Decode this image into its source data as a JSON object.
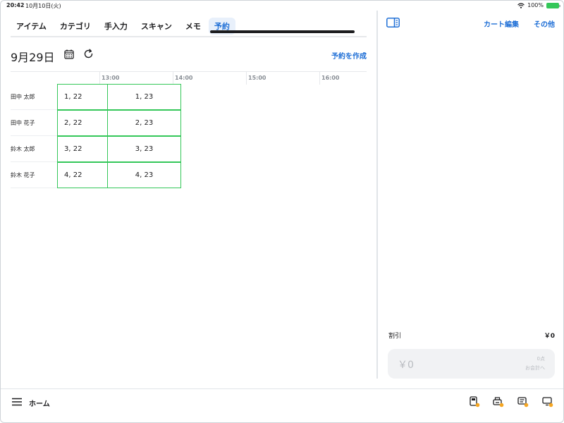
{
  "status_bar": {
    "time": "20:42",
    "date": "10月10日(火)",
    "battery": "100%"
  },
  "tabs": [
    {
      "label": "アイテム",
      "active": false
    },
    {
      "label": "カテゴリ",
      "active": false
    },
    {
      "label": "手入力",
      "active": false
    },
    {
      "label": "スキャン",
      "active": false
    },
    {
      "label": "メモ",
      "active": false
    },
    {
      "label": "予約",
      "active": true
    }
  ],
  "schedule": {
    "date_label": "9月29日",
    "create_button": "予約を作成",
    "time_ticks": [
      "",
      "13:00",
      "14:00",
      "15:00",
      "16:00"
    ],
    "rows": [
      {
        "staff": "田中 太郎",
        "slots": [
          "1, 22",
          "1, 23"
        ]
      },
      {
        "staff": "田中 花子",
        "slots": [
          "2, 22",
          "2, 23"
        ]
      },
      {
        "staff": "鈴木 太郎",
        "slots": [
          "3, 22",
          "3, 23"
        ]
      },
      {
        "staff": "鈴木 花子",
        "slots": [
          "4, 22",
          "4, 23"
        ]
      }
    ]
  },
  "cart": {
    "edit_label": "カート編集",
    "more_label": "その他",
    "discount_label": "割引",
    "discount_value": "￥0",
    "checkout_amount": "￥0",
    "checkout_count": "0点",
    "checkout_label": "お会計へ"
  },
  "bottom_bar": {
    "home_label": "ホーム"
  },
  "colors": {
    "accent": "#1f6fd6",
    "slot_border": "#34c759",
    "active_tab_bg": "#e8f0fb",
    "notification_dot": "#f5a623"
  }
}
